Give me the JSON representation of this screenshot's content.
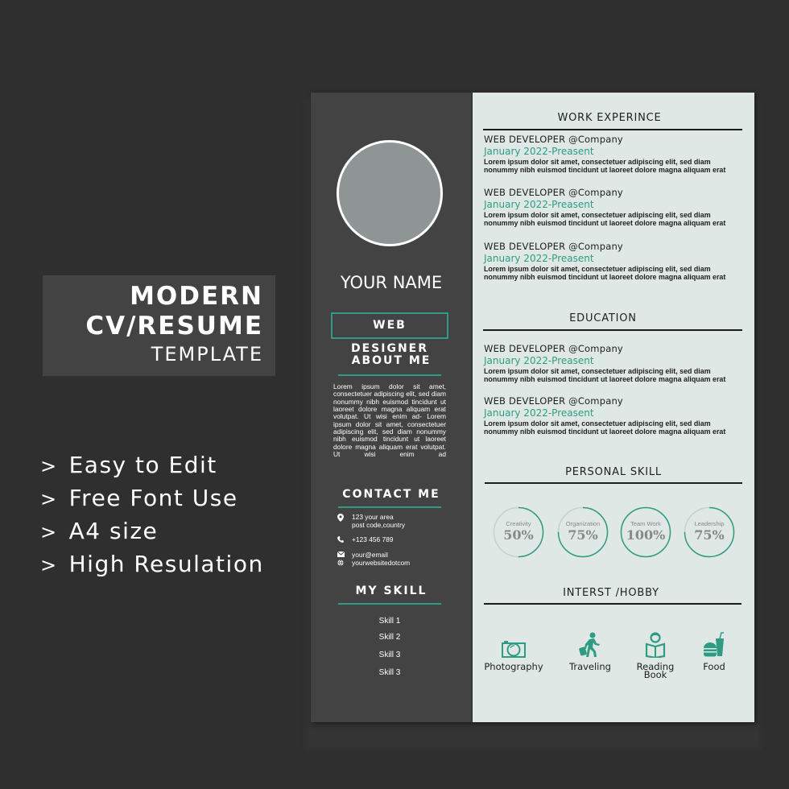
{
  "promo": {
    "line1": "MODERN",
    "line2": "CV/RESUME",
    "line3": "TEMPLATE"
  },
  "features": [
    {
      "bullet": ">",
      "text": "Easy to Edit"
    },
    {
      "bullet": ">",
      "text": "Free Font Use"
    },
    {
      "bullet": ">",
      "text": "A4 size"
    },
    {
      "bullet": ">",
      "text": "High Resulation"
    }
  ],
  "colors": {
    "accent": "#2e9c83",
    "sidebar": "#434344",
    "page": "#e0e8e6",
    "background": "#2f2f2f"
  },
  "resume": {
    "name": "YOUR NAME",
    "role": "WEB DESIGNER",
    "about": {
      "heading": "ABOUT ME",
      "text": "Lorem ipsum dolor sit amet, consectetuer adipiscing elit, sed diam nonummy nibh euismod tincidunt ut laoreet dolore magna aliquam erat volutpat. Ut wisi enim ad- Lorem ipsum dolor sit amet, consectetuer adipiscing elit, sed diam nonummy nibh euismod tincidunt ut laoreet dolore magna aliquam erat volutpat. Ut wisi enim ad"
    },
    "contact": {
      "heading": "CONTACT ME",
      "address_line1": "123 your area",
      "address_line2": "post code,country",
      "phone": "+123 456 789",
      "email": "your@email",
      "website": "yourwebsitedotcom"
    },
    "my_skill": {
      "heading": "MY SKILL",
      "items": [
        "Skill 1",
        "Skill 2",
        "Skill 3",
        "Skill 3"
      ]
    },
    "work": {
      "heading": "WORK EXPERINCE",
      "entries": [
        {
          "title": "WEB DEVELOPER @Company",
          "date": "January 2022-Preasent",
          "line1": "Lorem ipsum dolor sit amet, consectetuer adipiscing elit, sed diam",
          "line2": "nonummy nibh euismod tincidunt ut laoreet dolore magna aliquam erat"
        },
        {
          "title": "WEB DEVELOPER @Company",
          "date": "January 2022-Preasent",
          "line1": "Lorem ipsum dolor sit amet, consectetuer adipiscing elit, sed diam",
          "line2": "nonummy nibh euismod tincidunt ut laoreet dolore magna aliquam erat"
        },
        {
          "title": "WEB DEVELOPER @Company",
          "date": "January 2022-Preasent",
          "line1": "Lorem ipsum dolor sit amet, consectetuer adipiscing elit, sed diam",
          "line2": "nonummy nibh euismod tincidunt ut laoreet dolore magna aliquam erat"
        }
      ]
    },
    "education": {
      "heading": "EDUCATION",
      "entries": [
        {
          "title": "WEB DEVELOPER @Company",
          "date": "January 2022-Preasent",
          "line1": "Lorem ipsum dolor sit amet, consectetuer adipiscing elit, sed diam",
          "line2": "nonummy nibh euismod tincidunt ut laoreet dolore magna aliquam erat"
        },
        {
          "title": "WEB DEVELOPER @Company",
          "date": "January 2022-Preasent",
          "line1": "Lorem ipsum dolor sit amet, consectetuer adipiscing elit, sed diam",
          "line2": "nonummy nibh euismod tincidunt ut laoreet dolore magna aliquam erat"
        }
      ]
    },
    "personal_skill": {
      "heading": "PERSONAL SKILL",
      "items": [
        {
          "label": "Creativity",
          "value": "50%",
          "percent": 50
        },
        {
          "label": "Organization",
          "value": "75%",
          "percent": 75
        },
        {
          "label": "Team Work",
          "value": "100%",
          "percent": 100
        },
        {
          "label": "Leadership",
          "value": "75%",
          "percent": 75
        }
      ]
    },
    "hobby": {
      "heading": "INTERST /HOBBY",
      "items": [
        {
          "icon": "camera-icon",
          "label_line1": "Photography",
          "label_line2": ""
        },
        {
          "icon": "traveler-icon",
          "label_line1": "Traveling",
          "label_line2": ""
        },
        {
          "icon": "reading-book-icon",
          "label_line1": "Reading",
          "label_line2": "Book"
        },
        {
          "icon": "food-icon",
          "label_line1": "Food",
          "label_line2": ""
        }
      ]
    }
  }
}
